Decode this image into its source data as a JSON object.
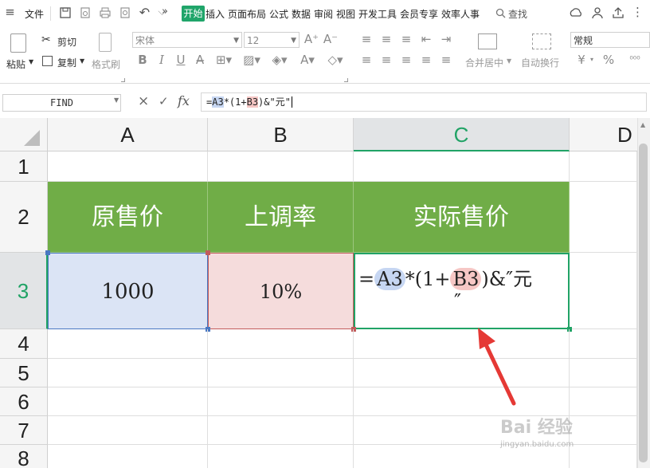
{
  "menubar": {
    "file_label": "文件",
    "tabs": [
      "开始",
      "插入",
      "页面布局",
      "公式",
      "数据",
      "审阅",
      "视图",
      "开发工具",
      "会员专享",
      "效率人事"
    ],
    "more_glyph": "»",
    "search_label": "查找"
  },
  "ribbon": {
    "paste_label": "粘贴",
    "cut_label": "剪切",
    "copy_label": "复制",
    "format_painter_label": "格式刷",
    "font_name": "宋体",
    "font_size": "12",
    "merge_label": "合并居中",
    "wrap_label": "自动换行",
    "number_format": "常规",
    "currency_glyph": "¥",
    "percent_glyph": "%"
  },
  "formula_bar": {
    "name_box": "FIND",
    "fx_label": "fx",
    "formula_parts": {
      "eq": "=",
      "a3": "A3",
      "mid": "*(1+",
      "b3": "B3",
      "tail": ")&\"元\""
    }
  },
  "columns": [
    "A",
    "B",
    "C",
    "D"
  ],
  "rows": [
    "1",
    "2",
    "3",
    "4",
    "5",
    "6",
    "7",
    "8"
  ],
  "cells": {
    "A2": "原售价",
    "B2": "上调率",
    "C2": "实际售价",
    "A3": "1000",
    "B3": "10%",
    "C3_parts": {
      "eq": "=",
      "a3": "A3",
      "mid": "*(1+",
      "b3": "B3",
      "tail": ")&″元",
      "wrap": "″"
    }
  },
  "watermark": {
    "logo": "Bai 经验",
    "url": "jingyan.baidu.com"
  },
  "colors": {
    "header_green": "#70ad47",
    "a3_blue": "#dbe4f5",
    "b3_pink": "#f5dcdc",
    "active_green": "#21a366",
    "accent": "#20a56a"
  }
}
